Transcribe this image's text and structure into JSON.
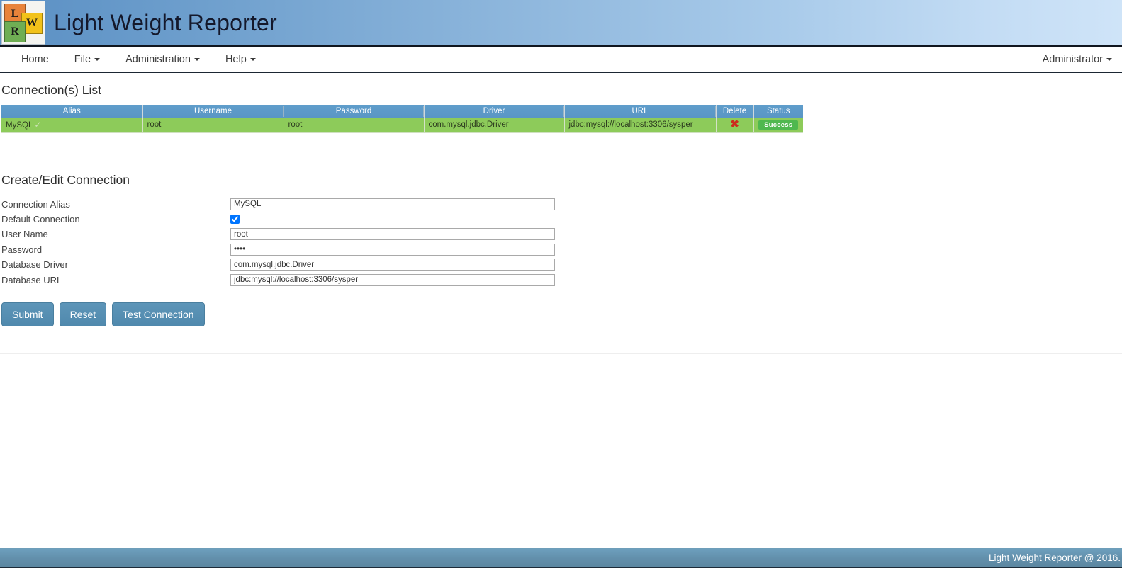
{
  "header": {
    "title": "Light Weight Reporter",
    "logo": {
      "tile_l": "L",
      "tile_w": "W",
      "tile_r": "R"
    }
  },
  "navbar": {
    "items": [
      {
        "label": "Home",
        "has_caret": false
      },
      {
        "label": "File",
        "has_caret": true
      },
      {
        "label": "Administration",
        "has_caret": true
      },
      {
        "label": "Help",
        "has_caret": true
      }
    ],
    "user": {
      "label": "Administrator",
      "has_caret": true
    }
  },
  "connections": {
    "section_title": "Connection(s) List",
    "columns": [
      "Alias",
      "Username",
      "Password",
      "Driver",
      "URL",
      "Delete",
      "Status"
    ],
    "rows": [
      {
        "alias": "MySQL",
        "alias_default_mark": "✓",
        "username": "root",
        "password": "root",
        "driver": "com.mysql.jdbc.Driver",
        "url": "jdbc:mysql://localhost:3306/sysper",
        "delete_icon": "✖",
        "status": "Success"
      }
    ]
  },
  "form": {
    "section_title": "Create/Edit Connection",
    "fields": [
      {
        "label": "Connection Alias",
        "type": "text",
        "value": "MySQL",
        "placeholder": ""
      },
      {
        "label": "Default Connection",
        "type": "checkbox",
        "checked": true
      },
      {
        "label": "User Name",
        "type": "text",
        "value": "root",
        "placeholder": ""
      },
      {
        "label": "Password",
        "type": "password",
        "value": "root",
        "placeholder": ""
      },
      {
        "label": "Database Driver",
        "type": "text",
        "value": "com.mysql.jdbc.Driver",
        "placeholder": ""
      },
      {
        "label": "Database URL",
        "type": "text",
        "value": "jdbc:mysql://localhost:3306/sysper",
        "placeholder": ""
      }
    ],
    "buttons": {
      "submit": "Submit",
      "reset": "Reset",
      "test": "Test Connection"
    }
  },
  "footer": {
    "text": "Light Weight Reporter @ 2016."
  },
  "colors": {
    "header_gradient_start": "#5b90c4",
    "header_gradient_end": "#cfe4f8",
    "table_header": "#5a96c5",
    "table_row": "#8dcb5a",
    "status_success": "#4fb84f",
    "delete_red": "#cc2b1d",
    "button_blue": "#5089ad",
    "footer_blue": "#628fab"
  }
}
